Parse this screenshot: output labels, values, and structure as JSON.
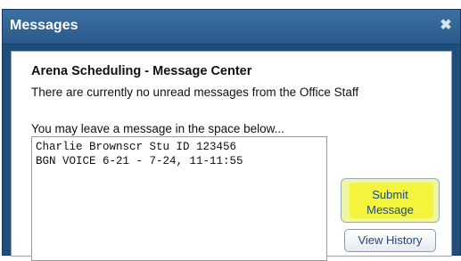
{
  "dialog": {
    "title": "Messages",
    "close_glyph": "✖",
    "close_icon": "close-icon"
  },
  "content": {
    "heading": "Arena Scheduling - Message Center",
    "status": "There are currently no unread messages from the Office Staff",
    "prompt": "You may leave a message in the space below...",
    "message_value": "Charlie Brownscr Stu ID 123456\nBGN VOICE 6-21 - 7-24, 11-11:55"
  },
  "buttons": {
    "submit_label": "Submit\nMessage",
    "history_label": "View History"
  },
  "colors": {
    "titlebar": "#2a5a8a",
    "highlight": "#f4f43c",
    "link_text": "#1a4a8a"
  }
}
